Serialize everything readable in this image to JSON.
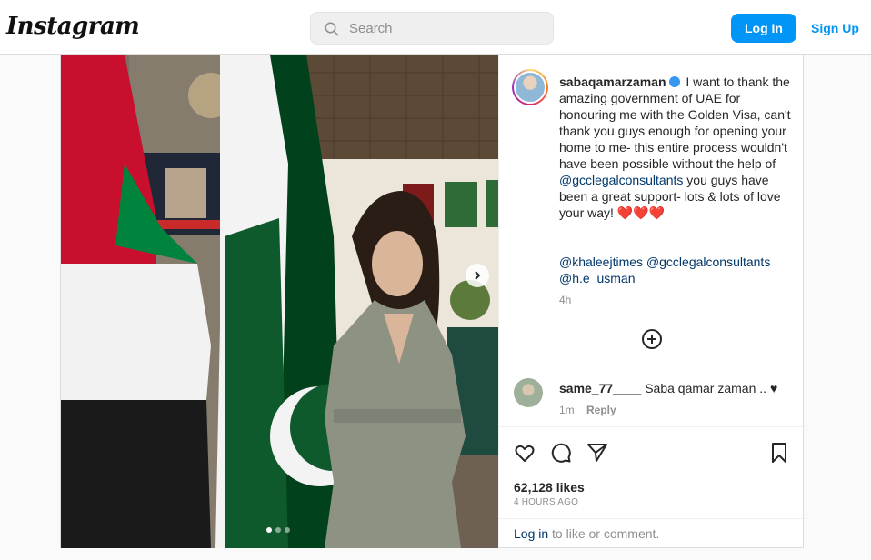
{
  "header": {
    "logo": "Instagram",
    "search_placeholder": "Search",
    "login_label": "Log In",
    "signup_label": "Sign Up"
  },
  "post": {
    "username": "sabaqamarzaman",
    "caption_text": "I want to thank the amazing government of UAE for honouring me with the Golden Visa, can't thank you guys enough for opening your home to me- this entire process wouldn't have been possible without the help of",
    "caption_mention": "@gcclegalconsultants",
    "caption_end": "you guys have been a great support- lots & lots of love your way! ❤️❤️❤️",
    "tags": [
      "@khaleejtimes",
      "@gcclegalconsultants",
      "@h.e_usman"
    ],
    "time_ago": "4h",
    "likes": "62,128 likes",
    "posted": "4 HOURS AGO",
    "carousel": {
      "slides": 3,
      "active": 1
    }
  },
  "comment": {
    "username": "same_77____",
    "text": "Saba qamar zaman .. ♥",
    "time": "1m",
    "reply_label": "Reply"
  },
  "footer": {
    "login_link": "Log in",
    "login_rest": " to like or comment."
  },
  "colors": {
    "accent": "#0095f6",
    "link": "#00376b",
    "muted": "#8e8e8e"
  },
  "icons": [
    "search-icon",
    "chevron-right-icon",
    "add-circle-icon",
    "heart-icon",
    "comment-icon",
    "share-icon",
    "bookmark-icon",
    "verified-icon"
  ]
}
